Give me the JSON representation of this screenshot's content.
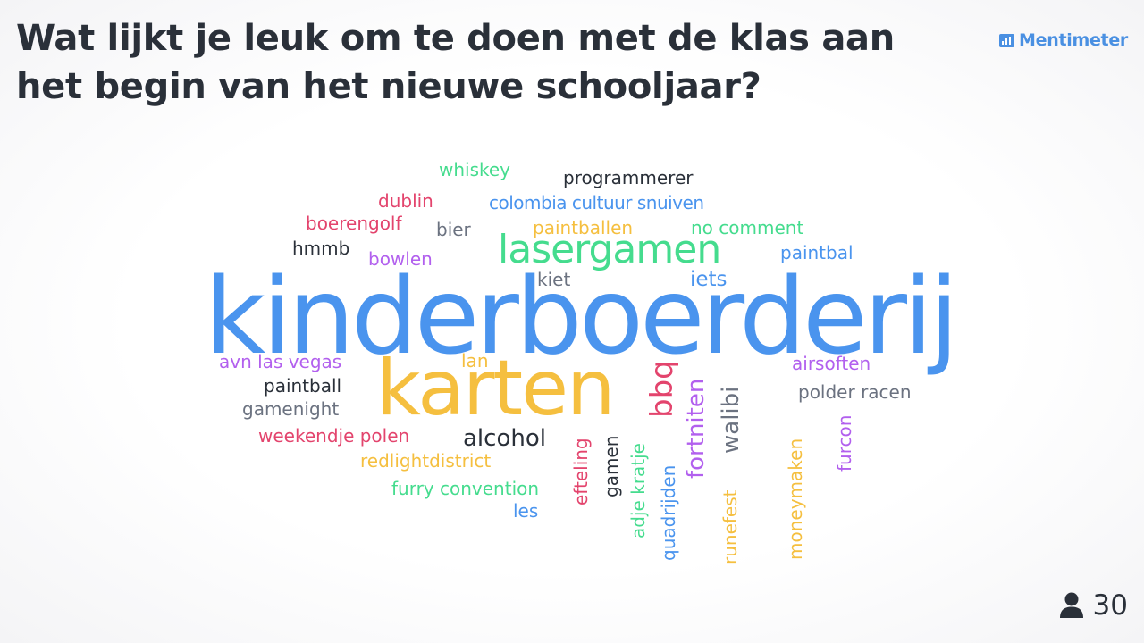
{
  "question": "Wat lijkt je leuk om te doen met de klas aan het begin van het nieuwe schooljaar?",
  "brand": {
    "name": "Mentimeter",
    "icon": "bar-chart-icon",
    "color": "#4a90e2"
  },
  "participants": {
    "icon": "person-icon",
    "count": "30"
  },
  "palette": {
    "blue": "#4a94ee",
    "yellow": "#f5bf3f",
    "green": "#45dc8e",
    "red": "#e3446d",
    "purple": "#b260ee",
    "dark": "#2a3039",
    "gray": "#6b7280"
  },
  "words": [
    {
      "text": "kinderboerderij",
      "color": "blue"
    },
    {
      "text": "karten",
      "color": "yellow"
    },
    {
      "text": "lasergamen",
      "color": "green"
    },
    {
      "text": "whiskey",
      "color": "green"
    },
    {
      "text": "programmerer",
      "color": "dark"
    },
    {
      "text": "dublin",
      "color": "red"
    },
    {
      "text": "colombia cultuur snuiven",
      "color": "blue"
    },
    {
      "text": "boerengolf",
      "color": "red"
    },
    {
      "text": "bier",
      "color": "gray"
    },
    {
      "text": "paintballen",
      "color": "yellow"
    },
    {
      "text": "no comment",
      "color": "green"
    },
    {
      "text": "hmmb",
      "color": "dark"
    },
    {
      "text": "bowlen",
      "color": "purple"
    },
    {
      "text": "paintbal",
      "color": "blue"
    },
    {
      "text": "kiet",
      "color": "gray"
    },
    {
      "text": "iets",
      "color": "blue"
    },
    {
      "text": "avn las vegas",
      "color": "purple"
    },
    {
      "text": "lan",
      "color": "yellow"
    },
    {
      "text": "airsoften",
      "color": "purple"
    },
    {
      "text": "paintball",
      "color": "dark"
    },
    {
      "text": "polder racen",
      "color": "gray"
    },
    {
      "text": "gamenight",
      "color": "gray"
    },
    {
      "text": "weekendje polen",
      "color": "red"
    },
    {
      "text": "alcohol",
      "color": "dark"
    },
    {
      "text": "redlightdistrict",
      "color": "yellow"
    },
    {
      "text": "furry convention",
      "color": "green"
    },
    {
      "text": "les",
      "color": "blue"
    },
    {
      "text": "bbq",
      "color": "red"
    },
    {
      "text": "fortniten",
      "color": "purple"
    },
    {
      "text": "walibi",
      "color": "gray"
    },
    {
      "text": "efteling",
      "color": "red"
    },
    {
      "text": "gamen",
      "color": "dark"
    },
    {
      "text": "adje kratje",
      "color": "green"
    },
    {
      "text": "quadrijden",
      "color": "blue"
    },
    {
      "text": "runefest",
      "color": "yellow"
    },
    {
      "text": "moneymaken",
      "color": "yellow"
    },
    {
      "text": "furcon",
      "color": "purple"
    }
  ]
}
